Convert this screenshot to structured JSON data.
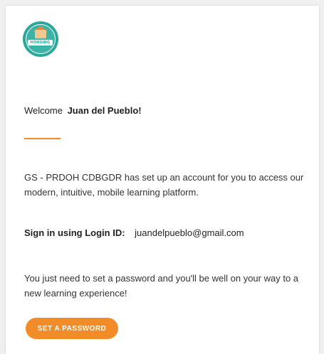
{
  "email": {
    "logo": {
      "icon": "housing-logo-icon",
      "text": "HOUSING",
      "colors": {
        "ring": "#2aa79b",
        "roof": "#e8833a"
      }
    },
    "greeting": {
      "prefix": "Welcome",
      "name": "Juan del Pueblo!"
    },
    "intro": "GS - PRDOH CDBGDR has set up an account for you to access our modern, intuitive, mobile learning platform.",
    "login": {
      "label": "Sign in using Login ID:",
      "id": "juandelpueblo@gmail.com"
    },
    "outro": "You just need to set a password and you'll be well on your way to a new learning experience!",
    "button": {
      "label": "SET A PASSWORD"
    },
    "accent_color": "#f28c28"
  }
}
